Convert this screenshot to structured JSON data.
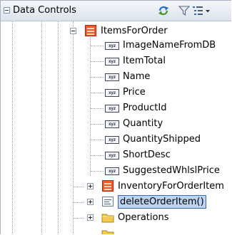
{
  "panel": {
    "title": "Data Controls",
    "toolbar": {
      "refresh_icon": "refresh-icon",
      "filter_icon": "filter-icon",
      "menu_icon": "menu-dropdown-icon"
    }
  },
  "tree": {
    "root": {
      "label": "ItemsForOrder",
      "icon": "collection-icon",
      "expanded": true
    },
    "attributes": [
      {
        "label": "ImageNameFromDB"
      },
      {
        "label": "ItemTotal"
      },
      {
        "label": "Name"
      },
      {
        "label": "Price"
      },
      {
        "label": "ProductId"
      },
      {
        "label": "Quantity"
      },
      {
        "label": "QuantityShipped"
      },
      {
        "label": "ShortDesc"
      },
      {
        "label": "SuggestedWhlslPrice"
      }
    ],
    "children": [
      {
        "label": "InventoryForOrderItem",
        "icon": "collection-icon",
        "expanded": false
      },
      {
        "label": "deleteOrderItem()",
        "icon": "method-icon",
        "expanded": false,
        "selected": true
      },
      {
        "label": "Operations",
        "icon": "folder-icon",
        "expanded": false
      }
    ]
  },
  "attribute_icon_text": "xyz",
  "colors": {
    "selection_fill": "#bcd3f2",
    "selection_border": "#3c68b0",
    "collection_icon": "#f05a2a",
    "folder_icon": "#f0c94d"
  }
}
